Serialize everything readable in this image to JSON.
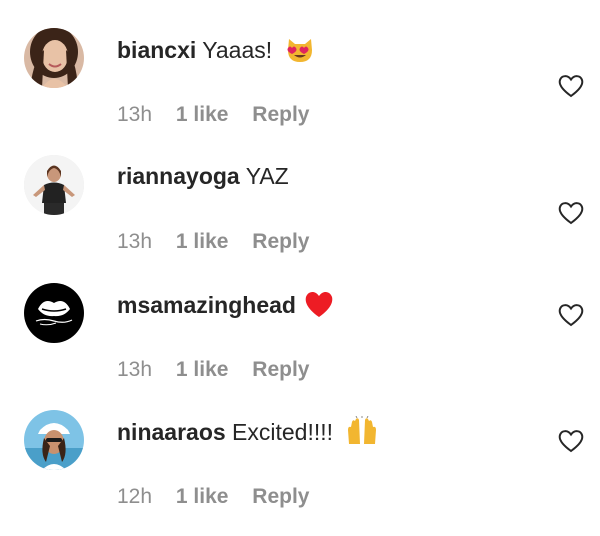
{
  "comments": [
    {
      "username": "biancxi",
      "text": "Yaaas!",
      "emoji": "heart-eyes-cat-emoji",
      "time": "13h",
      "likes": "1 like",
      "reply": "Reply"
    },
    {
      "username": "riannayoga",
      "text": "YAZ",
      "emoji": "",
      "time": "13h",
      "likes": "1 like",
      "reply": "Reply"
    },
    {
      "username": "msamazinghead",
      "text": "",
      "emoji": "red-heart-emoji",
      "time": "13h",
      "likes": "1 like",
      "reply": "Reply"
    },
    {
      "username": "ninaaraos",
      "text": "Excited!!!!",
      "emoji": "raising-hands-emoji",
      "time": "12h",
      "likes": "1 like",
      "reply": "Reply"
    }
  ],
  "colors": {
    "text": "#262626",
    "meta": "#8e8e8e",
    "heart_red": "#ed1c24"
  }
}
